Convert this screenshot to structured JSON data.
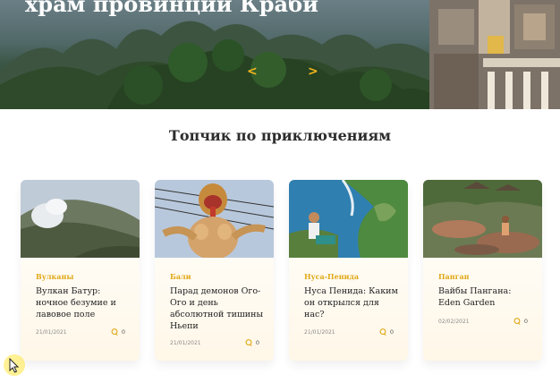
{
  "hero": {
    "title": "храм провинции Краби",
    "prev_arrow": "<",
    "next_arrow": ">"
  },
  "section": {
    "title": "Топчик по приключениям"
  },
  "cards": [
    {
      "category": "Вулканы",
      "title": "Вулкан Батур: ночное безумие и лавовое поле",
      "date": "21/01/2021",
      "comments": "0"
    },
    {
      "category": "Бали",
      "title": "Парад демонов Ого-Ого и день абсолютной тишины Ньепи",
      "date": "21/01/2021",
      "comments": "0"
    },
    {
      "category": "Нуса-Пенида",
      "title": "Нуса Пенида: Каким он открылся для нас?",
      "date": "21/01/2021",
      "comments": "0"
    },
    {
      "category": "Панган",
      "title": "Вайбы Пангана: Eden Garden",
      "date": "02/02/2021",
      "comments": "0"
    }
  ],
  "colors": {
    "accent": "#e0a817",
    "card_bg": "#fff8ea",
    "heading": "#2d2d2d"
  },
  "icons": {
    "comment": "comment-icon",
    "cursor": "mouse-cursor-icon"
  }
}
